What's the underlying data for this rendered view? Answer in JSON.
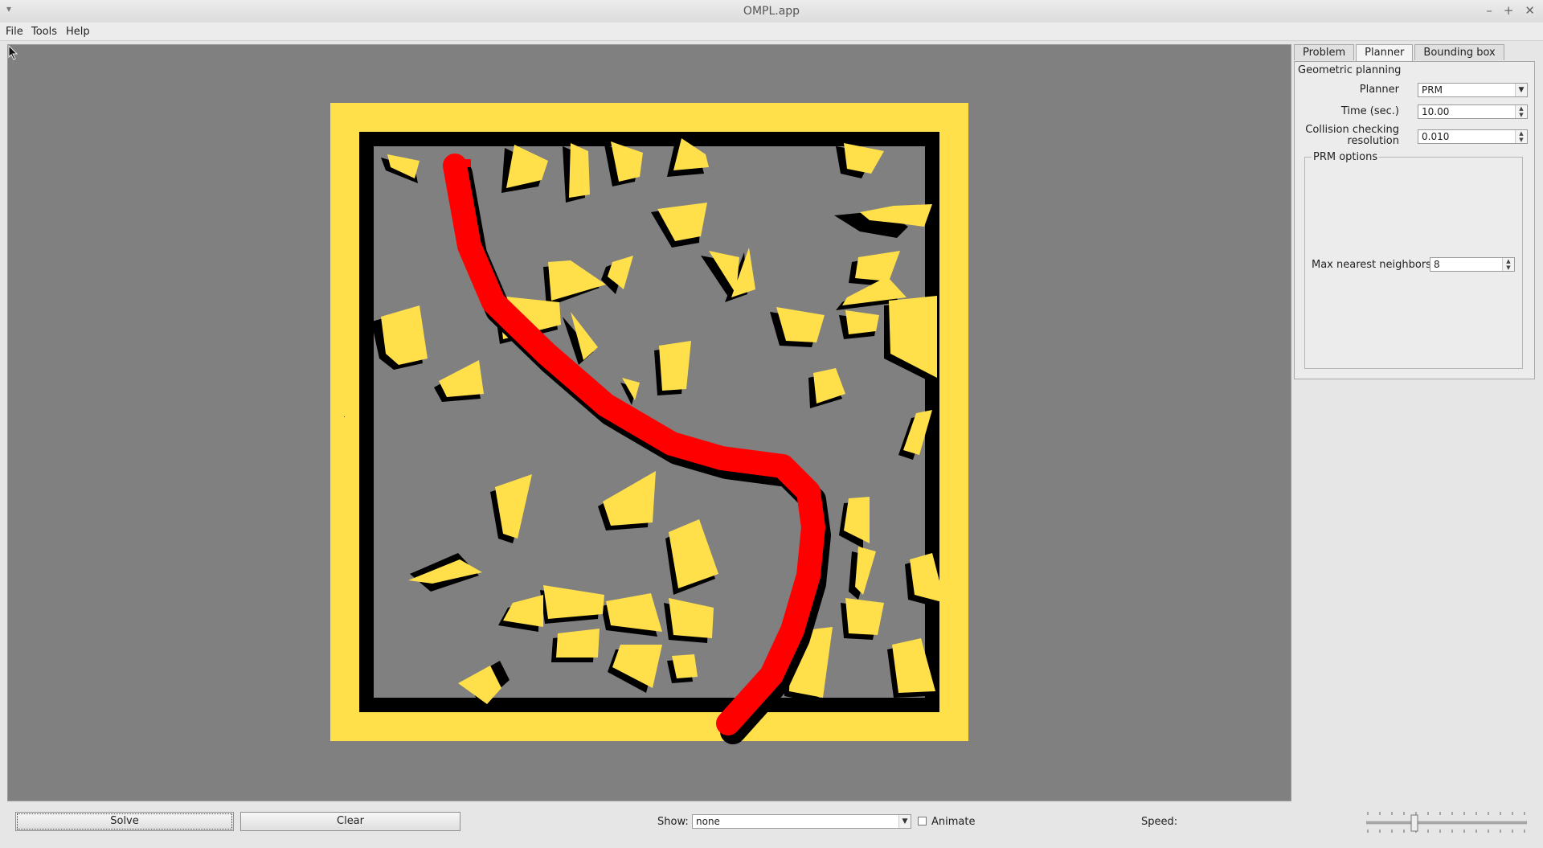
{
  "window": {
    "title": "OMPL.app",
    "menu_arrow": "▾",
    "minimize": "–",
    "maximize": "+",
    "close": "✕"
  },
  "menu": [
    "File",
    "Tools",
    "Help"
  ],
  "tabs": [
    {
      "label": "Problem"
    },
    {
      "label": "Planner"
    },
    {
      "label": "Bounding box"
    }
  ],
  "planner": {
    "group_title": "Geometric planning",
    "planner_label": "Planner",
    "planner_value": "PRM",
    "time_label": "Time (sec.)",
    "time_value": "10.00",
    "collision_label_1": "Collision checking",
    "collision_label_2": "resolution",
    "collision_value": "0.010",
    "options_title": "PRM options",
    "neighbors_label": "Max nearest neighbors",
    "neighbors_value": "8"
  },
  "bottom": {
    "solve_label": "Solve",
    "clear_label": "Clear",
    "show_label": "Show:",
    "show_value": "none",
    "animate_label": "Animate",
    "animate_checked": false,
    "speed_label": "Speed:",
    "speed_fraction": 0.3
  },
  "colors": {
    "obstacle": "#ffdf4a",
    "obstacle_shadow": "#000000",
    "path": "#ff0000",
    "viewport_bg": "#808080"
  }
}
